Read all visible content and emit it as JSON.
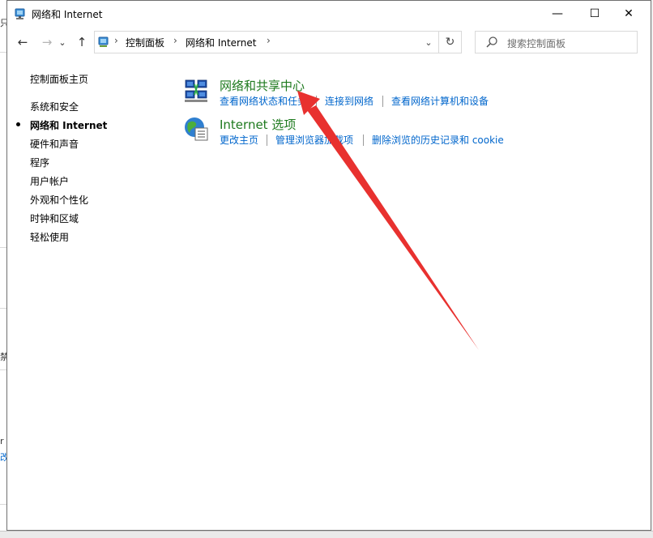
{
  "background": {
    "frag1": "只",
    "frag2": "禁",
    "frag3": "r",
    "frag4": "改网"
  },
  "window": {
    "title": "网络和 Internet",
    "controls": {
      "minimize": "—",
      "maximize": "☐",
      "close": "✕"
    }
  },
  "nav": {
    "back": "←",
    "forward": "→",
    "recent": "⌄",
    "up": "↑",
    "breadcrumb": [
      "控制面板",
      "网络和 Internet"
    ],
    "separator": "›",
    "dropdown": "⌄",
    "refresh": "↻",
    "search_placeholder": "搜索控制面板"
  },
  "sidebar": {
    "home": "控制面板主页",
    "items": [
      {
        "label": "系统和安全"
      },
      {
        "label": "网络和 Internet",
        "active": true
      },
      {
        "label": "硬件和声音"
      },
      {
        "label": "程序"
      },
      {
        "label": "用户帐户"
      },
      {
        "label": "外观和个性化"
      },
      {
        "label": "时钟和区域"
      },
      {
        "label": "轻松使用"
      }
    ]
  },
  "content": {
    "categories": [
      {
        "title": "网络和共享中心",
        "icon": "network-sharing-center-icon",
        "links": [
          "查看网络状态和任务",
          "连接到网络",
          "查看网络计算机和设备"
        ]
      },
      {
        "title": "Internet 选项",
        "icon": "internet-options-icon",
        "links": [
          "更改主页",
          "管理浏览器加载项",
          "删除浏览的历史记录和 cookie"
        ]
      }
    ]
  },
  "colors": {
    "category_title": "#1e7a1e",
    "link": "#0066cc",
    "annotation_arrow": "#e8312f"
  }
}
